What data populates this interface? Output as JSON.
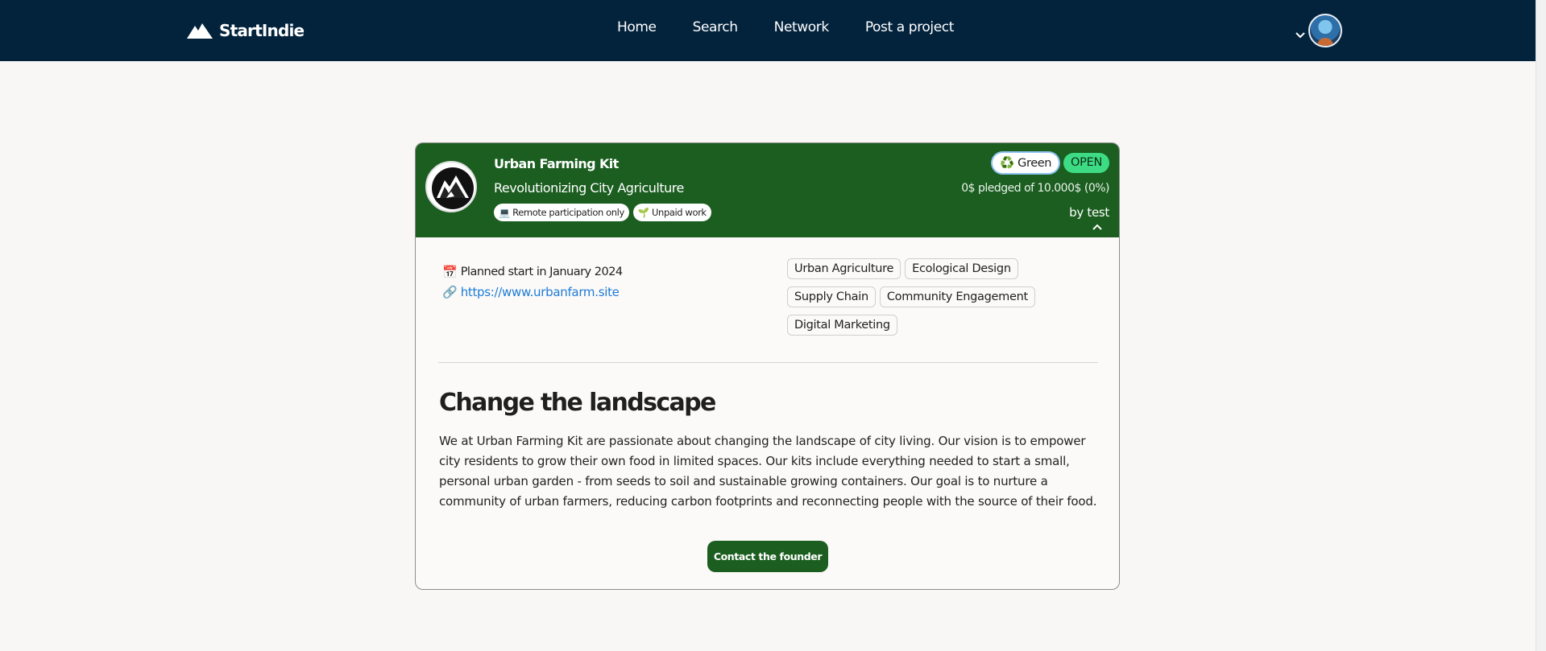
{
  "nav": {
    "brand": "StartIndie",
    "links": [
      "Home",
      "Search",
      "Network",
      "Post a project"
    ]
  },
  "project": {
    "title": "Urban Farming Kit",
    "subtitle": "Revolutionizing City Agriculture",
    "chips": [
      "💻 Remote participation only",
      "🌱 Unpaid work"
    ],
    "badge_green": "♻️ Green",
    "badge_status": "OPEN",
    "pledge": "0$ pledged of 10.000$ (0%)",
    "byline": "by test",
    "planned_icon": "📅",
    "planned": "Planned start in January 2024",
    "link_icon": "🔗",
    "website": "https://www.urbanfarm.site",
    "skills": [
      "Urban Agriculture",
      "Ecological Design",
      "Supply Chain",
      "Community Engagement",
      "Digital Marketing"
    ],
    "heading": "Change the landscape",
    "description": "We at Urban Farming Kit are passionate about changing the landscape of city living. Our vision is to empower city residents to grow their own food in limited spaces. Our kits include everything needed to start a small, personal urban garden - from seeds to soil and sustainable growing containers. Our goal is to nurture a community of urban farmers, reducing carbon footprints and reconnecting people with the source of their food.",
    "contact_label": "Contact the founder"
  },
  "colors": {
    "navbar": "#03233d",
    "header_green": "#1b5e20",
    "open_badge": "#3ddc84",
    "link": "#1e7bd6"
  },
  "icons": [
    "mountain-logo-icon",
    "chevron-down-icon",
    "chevron-up-icon",
    "project-logo-icon"
  ]
}
